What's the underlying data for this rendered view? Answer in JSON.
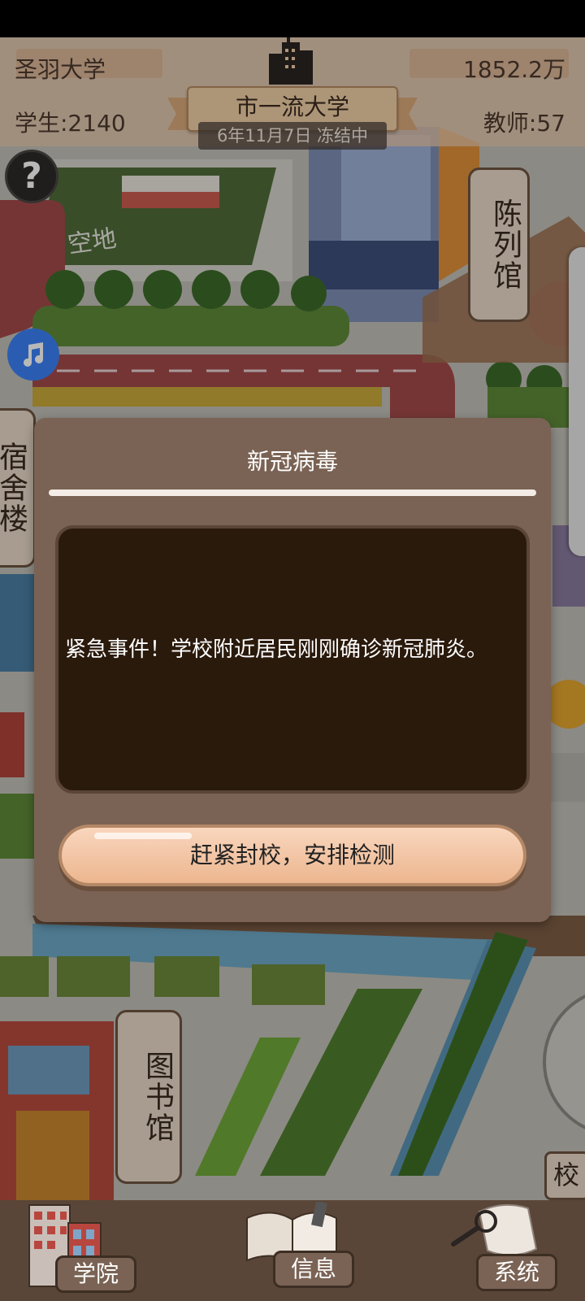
{
  "hud": {
    "university_name": "圣羽大学",
    "money": "1852.2万",
    "students": "学生:2140",
    "teachers": "教师:57",
    "rank_title": "市一流大学",
    "date_status": "6年11月7日 冻结中"
  },
  "map_labels": {
    "exhibition_hall": "陈列馆",
    "dormitory": "宿舍楼",
    "library": "图书馆",
    "school": "校",
    "empty_lot": "空地"
  },
  "dialog": {
    "title": "新冠病毒",
    "message": "紧急事件！学校附近居民刚刚确诊新冠肺炎。",
    "action_label": "赶紧封校，安排检测"
  },
  "bottom_nav": {
    "college": "学院",
    "info": "信息",
    "system": "系统"
  },
  "icons": [
    "help-icon",
    "music-note-icon",
    "city-skyline-icon",
    "college-building-icon",
    "book-icon",
    "magnifier-icon"
  ],
  "colors": {
    "dialog_bg": "#7a6354",
    "dialog_body_bg": "#2a1a0c",
    "action_button": "#f2c4a0",
    "music_button": "#3b82f6",
    "nav_bg": "#5a4638"
  }
}
